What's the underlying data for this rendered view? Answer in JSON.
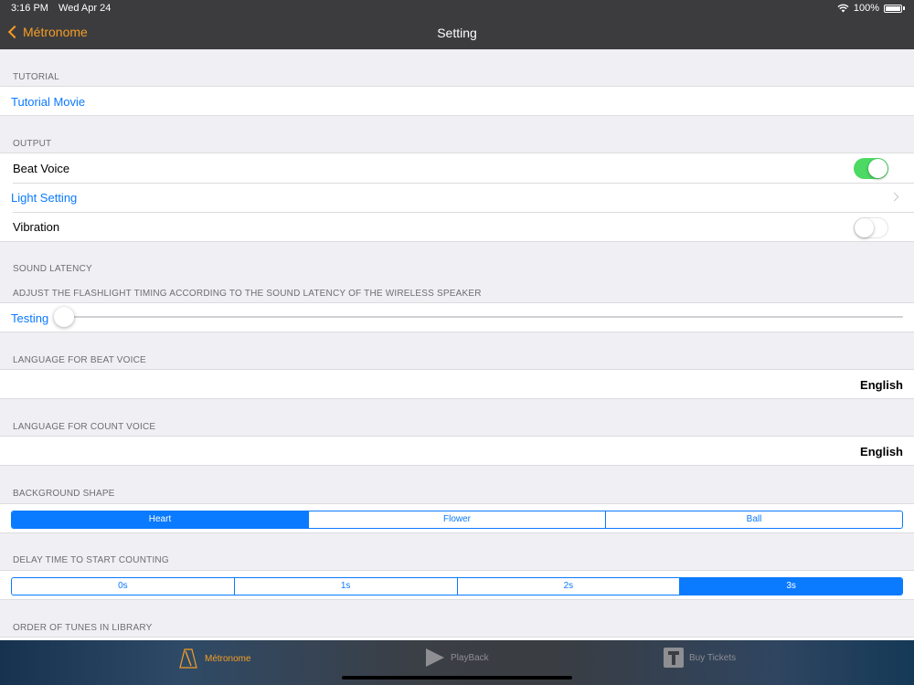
{
  "status_bar": {
    "time": "3:16 PM",
    "date": "Wed Apr 24",
    "battery": "100%"
  },
  "nav": {
    "back_label": "Métronome",
    "title": "Setting"
  },
  "tutorial": {
    "header": "TUTORIAL",
    "movie_label": "Tutorial Movie"
  },
  "output": {
    "header": "OUTPUT",
    "beat_voice_label": "Beat Voice",
    "beat_voice_on": true,
    "light_setting_label": "Light Setting",
    "vibration_label": "Vibration",
    "vibration_on": false
  },
  "sound_latency": {
    "header": "SOUND LATENCY",
    "subheader": "ADJUST THE FLASHLIGHT TIMING ACCORDING TO THE SOUND LATENCY OF THE WIRELESS SPEAKER",
    "testing_label": "Testing",
    "slider_value": 0
  },
  "beat_voice_language": {
    "header": "LANGUAGE FOR BEAT VOICE",
    "value": "English"
  },
  "count_voice_language": {
    "header": "LANGUAGE FOR COUNT VOICE",
    "value": "English"
  },
  "background_shape": {
    "header": "BACKGROUND SHAPE",
    "options": [
      "Heart",
      "Flower",
      "Ball"
    ],
    "selected": "Heart"
  },
  "delay_time": {
    "header": "DELAY TIME TO START COUNTING",
    "options": [
      "0s",
      "1s",
      "2s",
      "3s"
    ],
    "selected": "3s"
  },
  "order_of_tunes": {
    "header": "ORDER OF TUNES IN LIBRARY"
  },
  "tab_bar": {
    "tabs": [
      {
        "label": "Métronome",
        "icon": "metronome-icon",
        "active": true
      },
      {
        "label": "PlayBack",
        "icon": "play-icon",
        "active": false
      },
      {
        "label": "Buy Tickets",
        "icon": "ticket-icon",
        "active": false
      }
    ]
  },
  "colors": {
    "accent_orange": "#f59d25",
    "ios_blue": "#0a7aff",
    "toggle_green": "#4cd964",
    "nav_bg": "#3c3c3e"
  }
}
